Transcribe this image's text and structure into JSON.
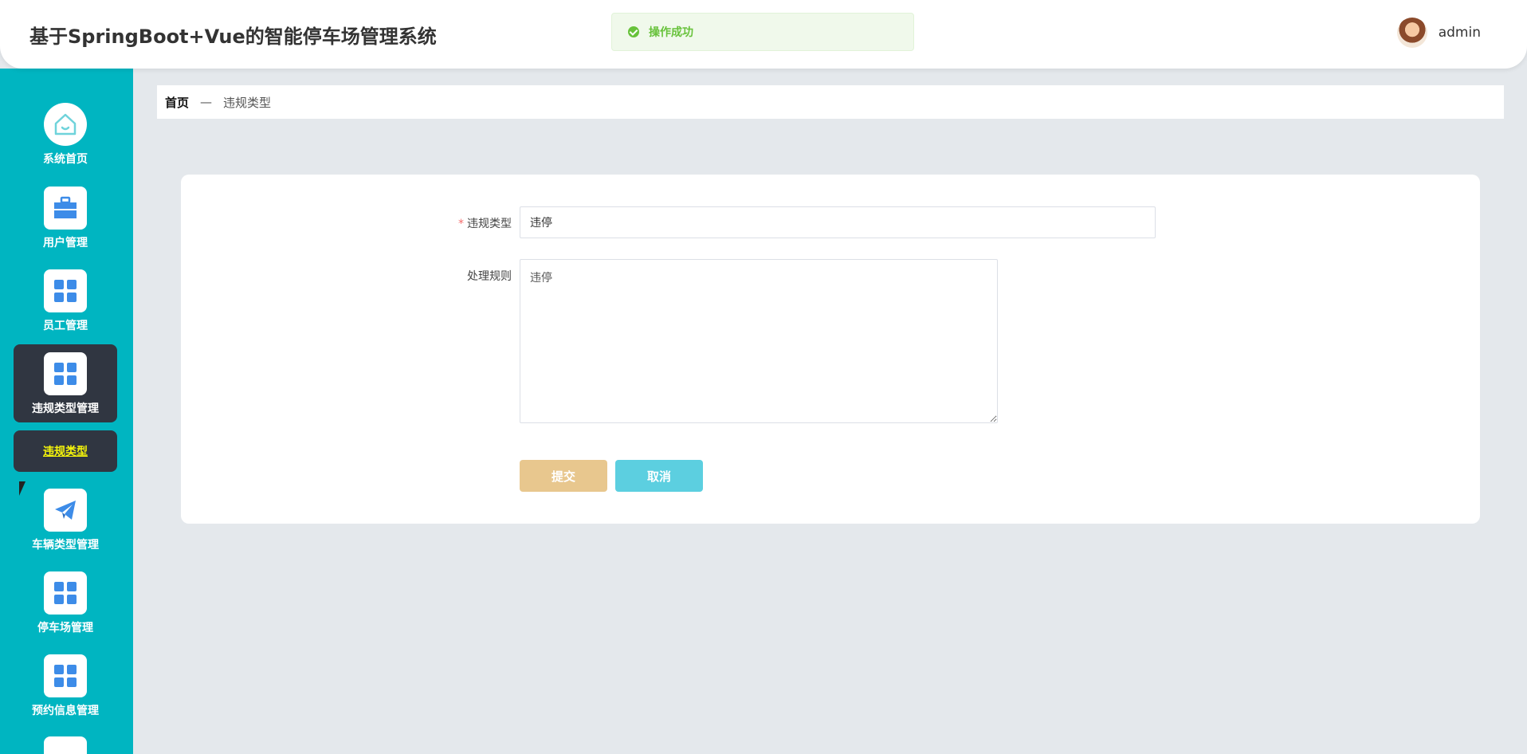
{
  "header": {
    "title": "基于SpringBoot+Vue的智能停车场管理系统",
    "toast": "操作成功",
    "user": "admin"
  },
  "sidebar": {
    "items": [
      {
        "label": "系统首页",
        "icon": "home-icon"
      },
      {
        "label": "用户管理",
        "icon": "briefcase-icon"
      },
      {
        "label": "员工管理",
        "icon": "grid-icon"
      },
      {
        "label": "违规类型管理",
        "icon": "grid-icon"
      },
      {
        "label": "车辆类型管理",
        "icon": "paper-plane-icon"
      },
      {
        "label": "停车场管理",
        "icon": "grid-icon"
      },
      {
        "label": "预约信息管理",
        "icon": "grid-icon"
      }
    ],
    "submenu": {
      "label": "违规类型"
    }
  },
  "breadcrumb": {
    "home": "首页",
    "separator": "—",
    "current": "违规类型"
  },
  "form": {
    "type_label": "违规类型",
    "type_value": "违停",
    "rule_label": "处理规则",
    "rule_value": "违停",
    "submit_label": "提交",
    "cancel_label": "取消"
  },
  "colors": {
    "sidebar": "#00b5c1",
    "active": "#303641",
    "submit": "#e8c78e",
    "cancel": "#5ccfe0",
    "toast": "#67c23a"
  }
}
